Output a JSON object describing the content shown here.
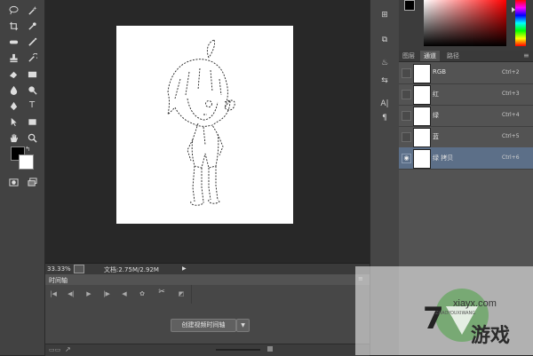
{
  "toolbar": {
    "tools": [
      "lasso-icon",
      "magic-wand-icon",
      "crop-icon",
      "eyedropper-icon",
      "healing-brush-icon",
      "brush-icon",
      "clone-stamp-icon",
      "history-brush-icon",
      "eraser-icon",
      "gradient-icon",
      "blur-icon",
      "dodge-icon",
      "pen-icon",
      "type-icon",
      "path-select-icon",
      "rectangle-icon",
      "hand-icon",
      "zoom-icon"
    ],
    "foreground_color": "#000000",
    "background_color": "#ffffff"
  },
  "status": {
    "zoom": "33.33%",
    "doc_info": "文档:2.75M/2.92M"
  },
  "timeline": {
    "tab_label": "时间轴",
    "create_button": "创建视频时间轴"
  },
  "channels_panel": {
    "tabs": [
      "图层",
      "通道",
      "路径"
    ],
    "active_tab": "通道",
    "rows": [
      {
        "name": "RGB",
        "shortcut": "Ctrl+2",
        "selected": false,
        "visible": false
      },
      {
        "name": "红",
        "shortcut": "Ctrl+3",
        "selected": false,
        "visible": false
      },
      {
        "name": "绿",
        "shortcut": "Ctrl+4",
        "selected": false,
        "visible": false
      },
      {
        "name": "蓝",
        "shortcut": "Ctrl+5",
        "selected": false,
        "visible": false
      },
      {
        "name": "绿 拷贝",
        "shortcut": "Ctrl+6",
        "selected": true,
        "visible": true
      }
    ]
  },
  "watermark": {
    "site": "xiayx.com",
    "sub": "ZHAOYOUXIWANG",
    "brand": "游戏"
  },
  "colors": {
    "panel_bg": "#535353",
    "selected_row": "#5c6f88",
    "workspace": "#282828"
  }
}
